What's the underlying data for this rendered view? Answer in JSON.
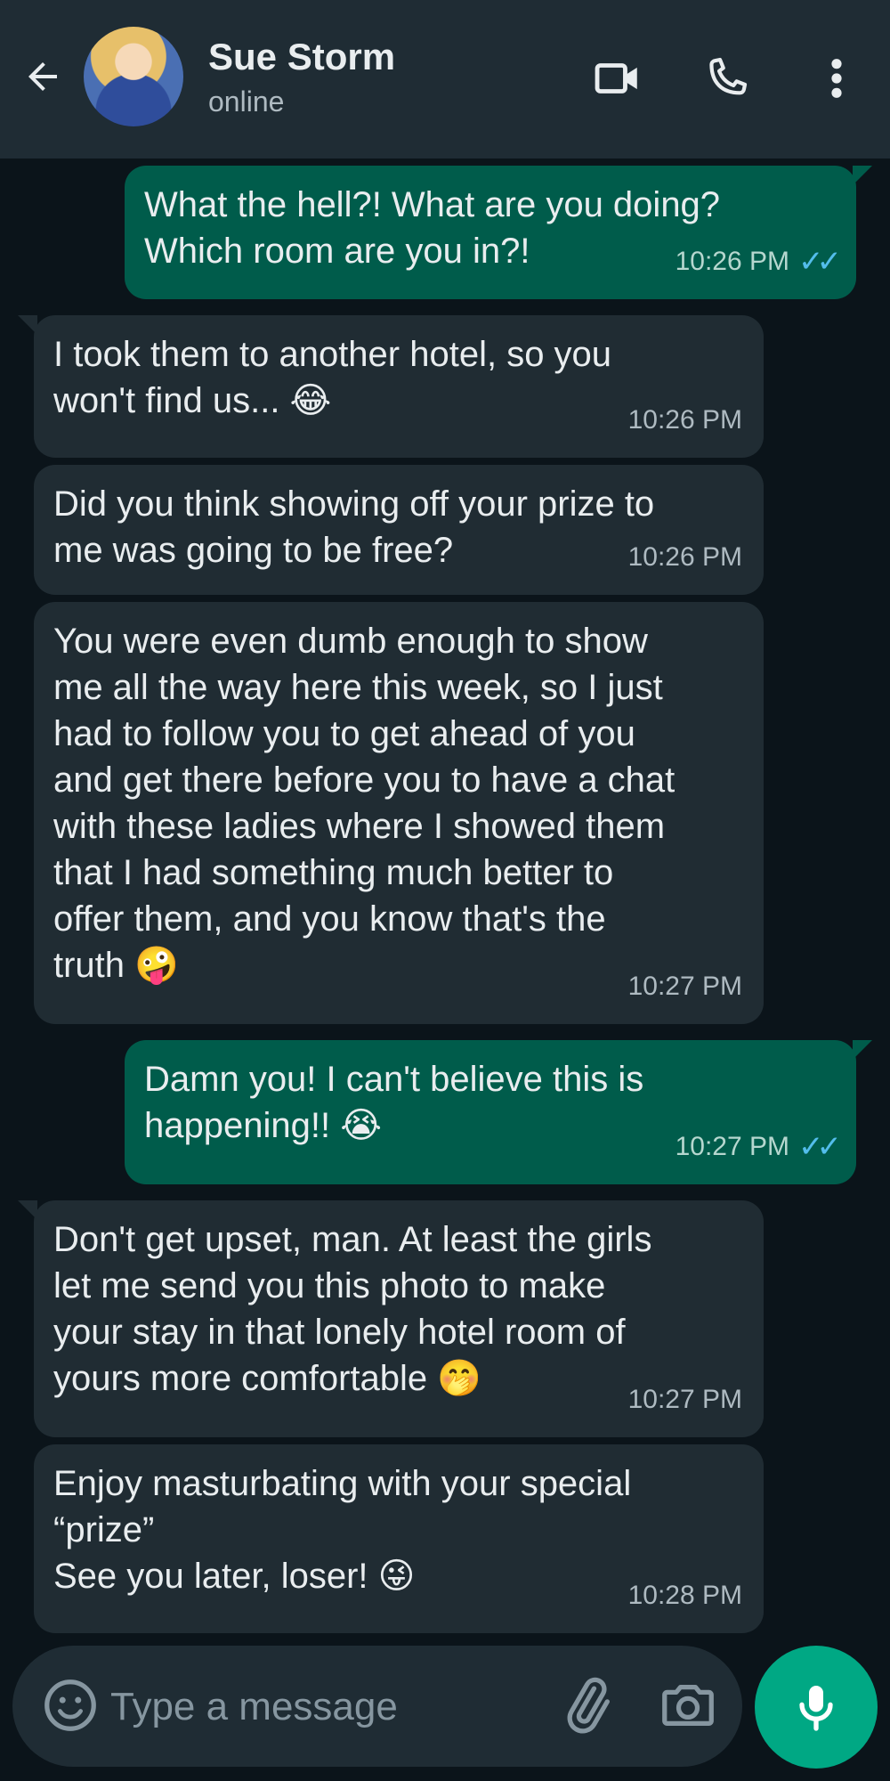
{
  "header": {
    "name": "Sue Storm",
    "status": "online"
  },
  "messages": [
    {
      "direction": "out",
      "text": "What the hell?! What are you doing?\nWhich room are you in?!",
      "time": "10:26 PM",
      "read": true
    },
    {
      "direction": "in",
      "text": "I took them to another hotel, so you\nwon't find us... 😂",
      "time": "10:26 PM"
    },
    {
      "direction": "in",
      "text": "Did you think showing off your prize to\nme was going to be free?",
      "time": "10:26 PM"
    },
    {
      "direction": "in",
      "text": "You were even dumb enough to show\nme all the way here this week, so I just\nhad to follow you to get ahead of you\nand get there before you to have a chat\nwith these ladies where I showed them\nthat I had something much better to\noffer them, and you know that's the\ntruth 🤪",
      "time": "10:27 PM"
    },
    {
      "direction": "out",
      "text": "Damn you! I can't believe this is\nhappening!! 😭",
      "time": "10:27 PM",
      "read": true
    },
    {
      "direction": "in",
      "text": "Don't get upset, man. At least the girls\nlet me send you this photo to make\nyour stay in that lonely hotel room of\nyours more comfortable 🤭",
      "time": "10:27 PM"
    },
    {
      "direction": "in",
      "text": "Enjoy masturbating with your special\n“prize”\nSee you later, loser! 😜",
      "time": "10:28 PM"
    }
  ],
  "composer": {
    "placeholder": "Type a message"
  },
  "colors": {
    "background": "#0b141a",
    "header": "#1f2c34",
    "incoming_bubble": "#202c33",
    "outgoing_bubble": "#005c4b",
    "read_ticks": "#53bdeb",
    "accent": "#00a884"
  }
}
